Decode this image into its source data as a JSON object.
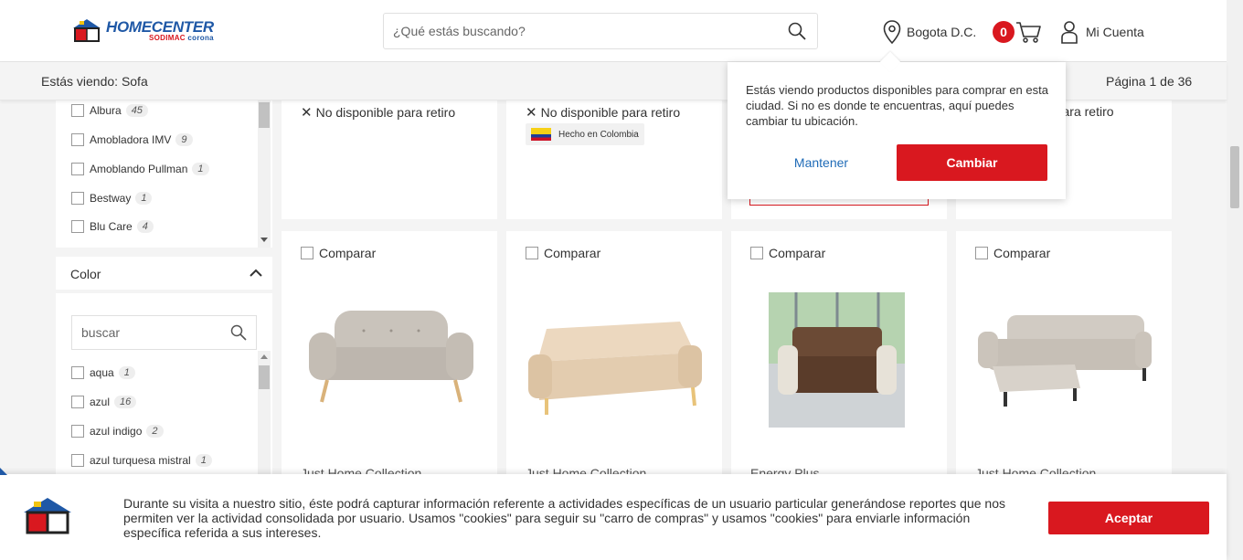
{
  "header": {
    "logo_text": "HOMECENTER",
    "logo_sub1": "SODIMAC",
    "logo_sub2": "corona",
    "search_placeholder": "¿Qué estás buscando?",
    "location": "Bogota D.C.",
    "cart_count": "0",
    "account_label": "Mi Cuenta"
  },
  "subbar": {
    "viewing": "Estás viendo: Sofa",
    "page": "Página 1 de 36"
  },
  "brand_filter": {
    "items": [
      {
        "label": "Albura",
        "count": "45"
      },
      {
        "label": "Amobladora IMV",
        "count": "9"
      },
      {
        "label": "Amoblando Pullman",
        "count": "1"
      },
      {
        "label": "Bestway",
        "count": "1"
      },
      {
        "label": "Blu Care",
        "count": "4"
      }
    ]
  },
  "color_filter": {
    "title": "Color",
    "search_placeholder": "buscar",
    "items": [
      {
        "label": "aqua",
        "count": "1"
      },
      {
        "label": "azul",
        "count": "16"
      },
      {
        "label": "azul indigo",
        "count": "2"
      },
      {
        "label": "azul turquesa mistral",
        "count": "1"
      }
    ]
  },
  "top_cards": {
    "not_available": "No disponible para retiro",
    "made_in": "Hecho en Colombia"
  },
  "products": [
    {
      "compare": "Comparar",
      "brand": "Just Home Collection"
    },
    {
      "compare": "Comparar",
      "brand": "Just Home Collection"
    },
    {
      "compare": "Comparar",
      "brand": "Energy Plus"
    },
    {
      "compare": "Comparar",
      "brand": "Just Home Collection"
    }
  ],
  "popup": {
    "message": "Estás viendo productos disponibles para comprar en esta ciudad. Si no es donde te encuentras, aquí puedes cambiar tu ubicación.",
    "keep": "Mantener",
    "change": "Cambiar"
  },
  "cookie": {
    "text": "Durante su visita a nuestro sitio, éste podrá capturar información referente a actividades específicas de un usuario particular generándose reportes que nos permiten ver la actividad consolidada por usuario. Usamos \"cookies\" para seguir su \"carro de compras\" y usamos \"cookies\" para enviarle información específica referida a sus intereses.",
    "accept": "Aceptar"
  },
  "colors": {
    "brand_blue": "#1f58a6",
    "brand_red": "#d9181f",
    "link_blue": "#1f6bb7"
  }
}
